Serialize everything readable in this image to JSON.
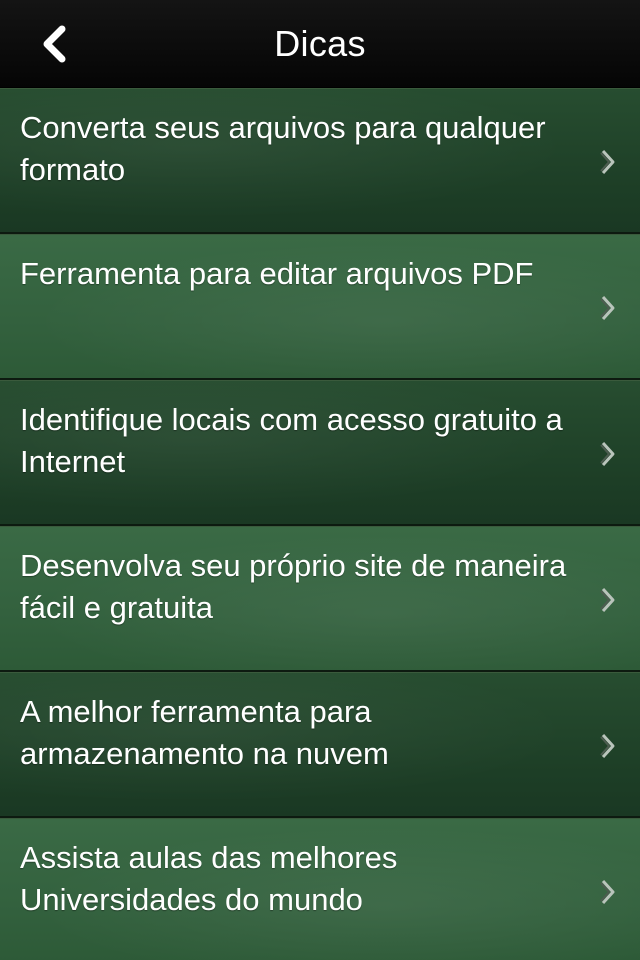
{
  "navbar": {
    "title": "Dicas",
    "back_icon": "chevron-left-icon"
  },
  "list": {
    "items": [
      {
        "label": "Converta seus arquivos para qualquer formato"
      },
      {
        "label": "Ferramenta para editar arquivos PDF"
      },
      {
        "label": "Identifique locais com acesso gratuito a Internet"
      },
      {
        "label": "Desenvolva seu próprio site de maneira fácil e gratuita"
      },
      {
        "label": "A melhor ferramenta para armazenamento na nuvem"
      },
      {
        "label": "Assista aulas das melhores Universidades do mundo"
      }
    ],
    "disclosure_icon": "chevron-right-icon"
  },
  "colors": {
    "navbar_bg": "#0a0a0a",
    "row_dark": "#1f4228",
    "row_light": "#33613e",
    "text": "#ffffff"
  }
}
